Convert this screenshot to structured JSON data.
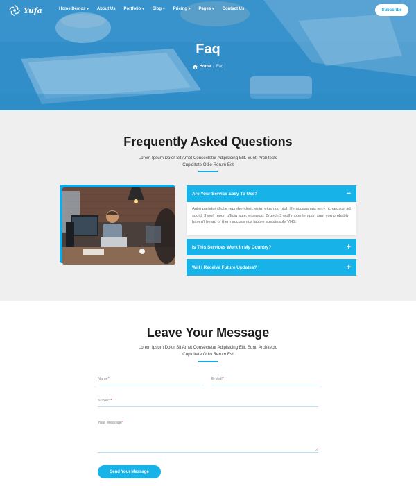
{
  "brand": {
    "name": "Yufa"
  },
  "nav": {
    "items": [
      {
        "label": "Home Demos",
        "dropdown": true
      },
      {
        "label": "About Us",
        "dropdown": false
      },
      {
        "label": "Portfolio",
        "dropdown": true
      },
      {
        "label": "Blog",
        "dropdown": true
      },
      {
        "label": "Pricing",
        "dropdown": true
      },
      {
        "label": "Pages",
        "dropdown": true
      },
      {
        "label": "Contact Us",
        "dropdown": false
      }
    ],
    "subscribe_label": "Subscribe"
  },
  "hero": {
    "title": "Faq",
    "breadcrumb": {
      "home": "Home",
      "separator": "/",
      "current": "Faq"
    }
  },
  "faq": {
    "title": "Frequently Asked Questions",
    "subtitle": "Lorem Ipsum Dolor Sit Amet Consectetur Adipisicing Elit. Sunt, Architecto Cupiditate Odio Rerum Est",
    "items": [
      {
        "question": "Are Your Service Easy To Use?",
        "expanded": true,
        "sign": "−",
        "answer": "Anim pariatur cliche reprehenderit, enim eiusmod high life accusamus terry richardson ad squid. 3 wolf moon officia aute, eiusmod. Brunch 3 wolf moon tempor, sunt you probably haven't heard of them accusamus labore sustainable VHS."
      },
      {
        "question": "Is This Services Work In My Country?",
        "expanded": false,
        "sign": "+"
      },
      {
        "question": "Will I Receive Future Updates?",
        "expanded": false,
        "sign": "+"
      }
    ]
  },
  "message": {
    "title": "Leave Your Message",
    "subtitle": "Lorem Ipsum Dolor Sit Amet Consectetur Adipisicing Elit. Sunt, Architecto Cupiditate Odio Rerum Est",
    "fields": {
      "name": "Name",
      "email": "E-Mail",
      "subject": "Subject",
      "message": "Your Message"
    },
    "required_mark": "*",
    "send_label": "Send Your Message"
  },
  "colors": {
    "accent": "#17b2e8",
    "hero_blue": "#3a95cc",
    "section_gray": "#efefef",
    "required": "#e2282c"
  },
  "icons": {
    "logo": "swirl-logo-icon",
    "dropdown": "chevron-down-icon",
    "home": "home-icon",
    "collapse": "minus-icon",
    "expand": "plus-icon"
  }
}
